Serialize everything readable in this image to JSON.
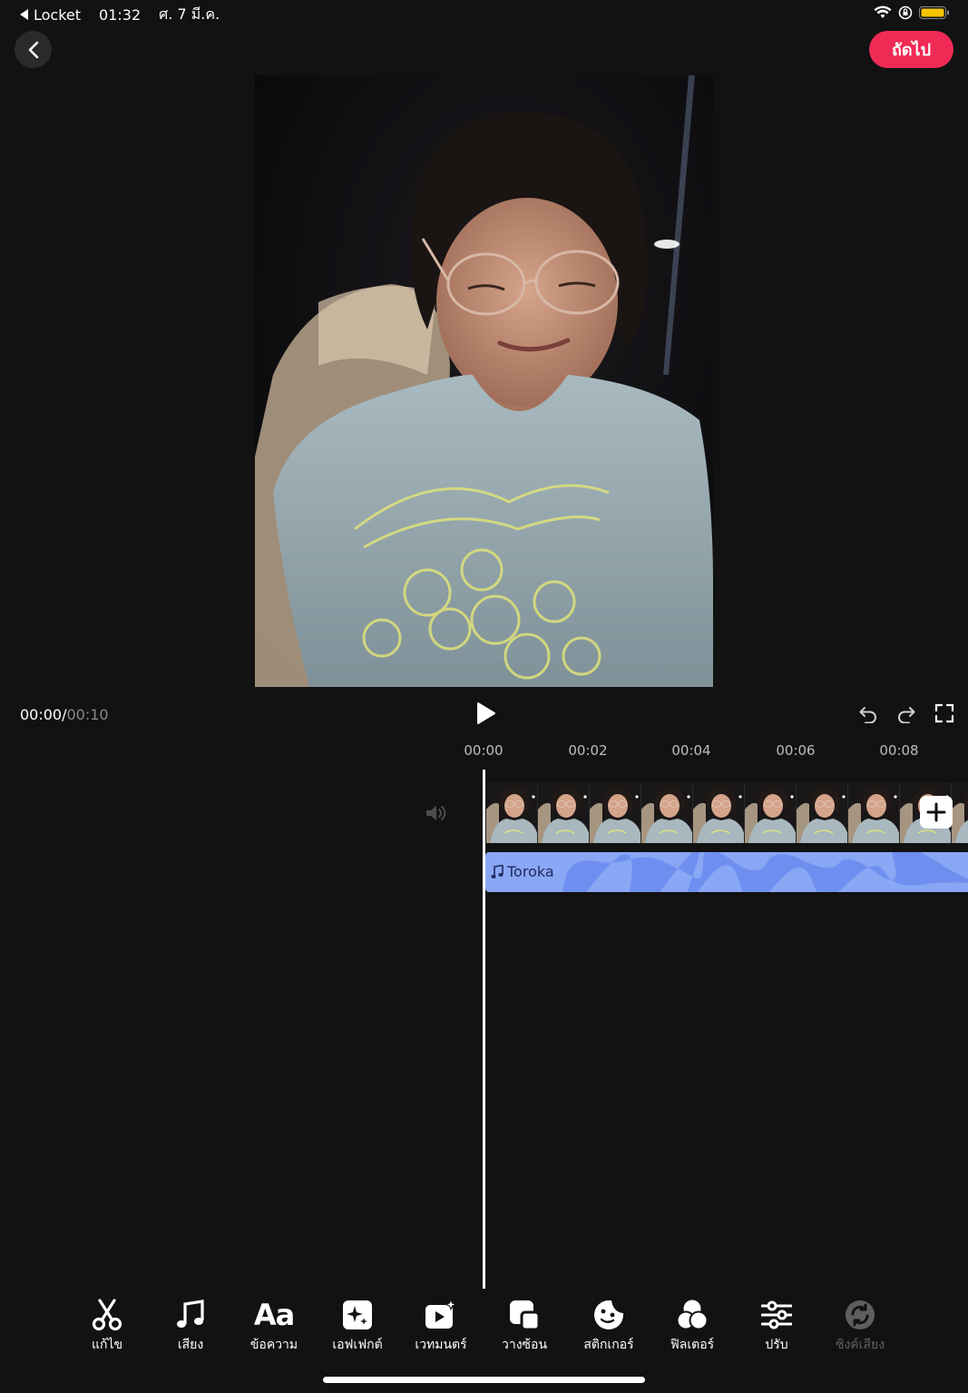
{
  "status_bar": {
    "back_app": "Locket",
    "time": "01:32",
    "date": "ศ. 7 มี.ค.",
    "icons": [
      "wifi-icon",
      "rotation-lock-icon",
      "battery-icon"
    ],
    "battery_color": "#f5c400"
  },
  "top_bar": {
    "back_icon": "chevron-left-icon",
    "next_label": "ถัดไป",
    "next_color": "#ef2a55"
  },
  "player": {
    "current_time": "00:00",
    "separator": "/",
    "total_time": "00:10",
    "play_icon": "play-icon",
    "tools": [
      "undo-icon",
      "redo-icon",
      "fullscreen-icon"
    ]
  },
  "timeline": {
    "ticks": [
      "00:00",
      "00:02",
      "00:04",
      "00:06",
      "00:08"
    ],
    "clip_thumbnail_count": 10,
    "add_clip_icon": "plus-icon",
    "volume_icon": "volume-icon",
    "audio_track": {
      "label": "Toroka",
      "icon": "music-note-icon",
      "color": "#8aa7f5"
    }
  },
  "toolbar": {
    "items": [
      {
        "label": "แก้ไข",
        "icon": "scissors-icon"
      },
      {
        "label": "เสียง",
        "icon": "music-note-icon"
      },
      {
        "label": "ข้อความ",
        "icon": "text-icon"
      },
      {
        "label": "เอฟเฟกต์",
        "icon": "effects-icon"
      },
      {
        "label": "เวทมนตร์",
        "icon": "magic-icon"
      },
      {
        "label": "วางซ้อน",
        "icon": "overlay-icon"
      },
      {
        "label": "สติกเกอร์",
        "icon": "sticker-icon"
      },
      {
        "label": "ฟิลเตอร์",
        "icon": "filter-icon"
      },
      {
        "label": "ปรับ",
        "icon": "adjust-icon"
      },
      {
        "label": "ซิงค์เสียง",
        "icon": "sync-audio-icon"
      }
    ],
    "text_icon_glyph": "Aa"
  }
}
